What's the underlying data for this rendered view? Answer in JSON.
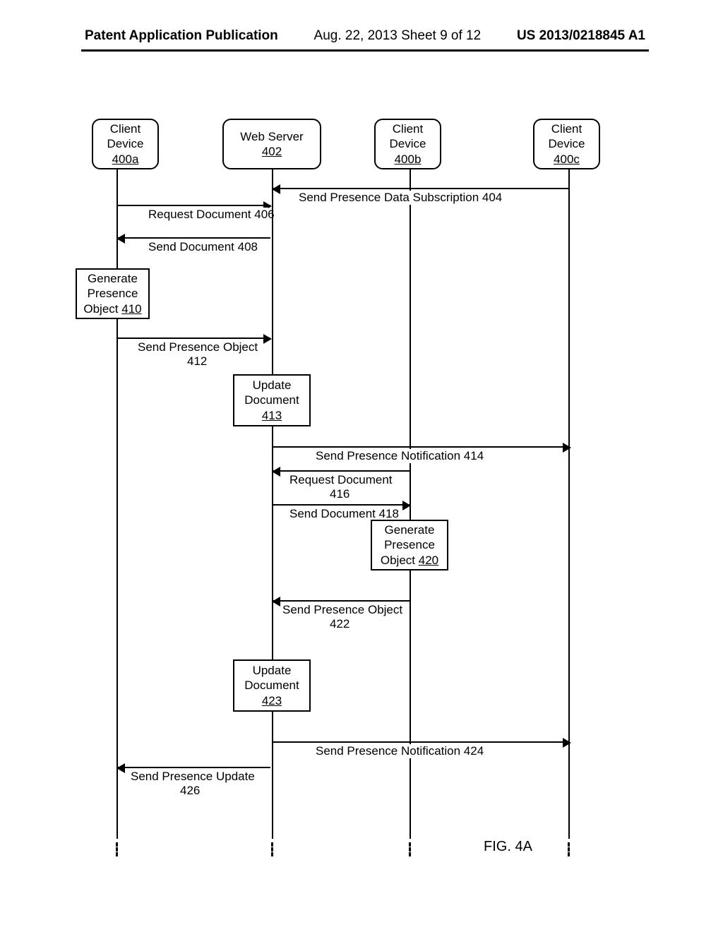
{
  "header": {
    "left": "Patent Application Publication",
    "middle": "Aug. 22, 2013  Sheet 9 of 12",
    "right": "US 2013/0218845 A1"
  },
  "participants": {
    "client_a": {
      "line1": "Client",
      "line2": "Device",
      "ref": "400a"
    },
    "web_server": {
      "line1": "Web Server",
      "ref": "402"
    },
    "client_b": {
      "line1": "Client",
      "line2": "Device",
      "ref": "400b"
    },
    "client_c": {
      "line1": "Client",
      "line2": "Device",
      "ref": "400c"
    }
  },
  "messages": {
    "m404": "Send Presence Data Subscription 404",
    "m406": "Request Document 406",
    "m408": "Send Document 408",
    "m412_a": "Send Presence Object",
    "m412_b": "412",
    "m414": "Send Presence Notification 414",
    "m416_a": "Request Document",
    "m416_b": "416",
    "m418": "Send Document 418",
    "m422_a": "Send Presence Object",
    "m422_b": "422",
    "m424": "Send Presence Notification 424",
    "m426_a": "Send Presence Update",
    "m426_b": "426"
  },
  "boxes": {
    "b410": {
      "l1": "Generate",
      "l2": "Presence",
      "l3": "Object",
      "ref": "410"
    },
    "b413": {
      "l1": "Update",
      "l2": "Document",
      "ref": "413"
    },
    "b420": {
      "l1": "Generate",
      "l2": "Presence",
      "l3": "Object",
      "ref": "420"
    },
    "b423": {
      "l1": "Update",
      "l2": "Document",
      "ref": "423"
    }
  },
  "figure": "FIG. 4A"
}
